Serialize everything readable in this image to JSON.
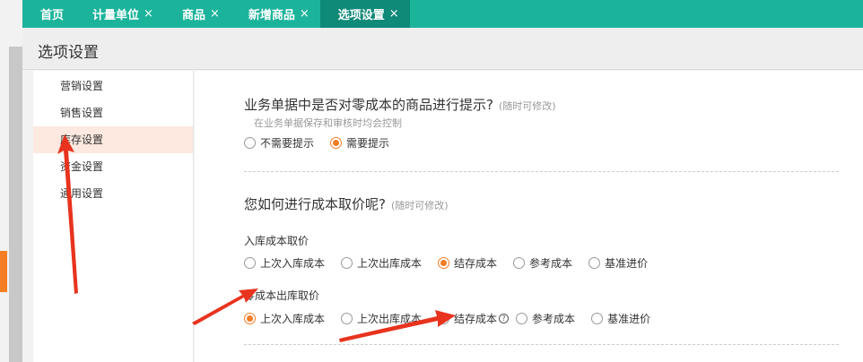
{
  "tabs": [
    {
      "label": "首页",
      "closable": false,
      "active": false
    },
    {
      "label": "计量单位",
      "closable": true,
      "active": false
    },
    {
      "label": "商品",
      "closable": true,
      "active": false
    },
    {
      "label": "新增商品",
      "closable": true,
      "active": false
    },
    {
      "label": "选项设置",
      "closable": true,
      "active": true
    }
  ],
  "close_glyph": "×",
  "page_title": "选项设置",
  "sidebar": {
    "items": [
      {
        "label": "营销设置"
      },
      {
        "label": "销售设置"
      },
      {
        "label": "库存设置"
      },
      {
        "label": "资金设置"
      },
      {
        "label": "通用设置"
      }
    ],
    "active_index": 2
  },
  "section1": {
    "title": "业务单据中是否对零成本的商品进行提示?",
    "note": "(随时可修改)",
    "subtitle": "在业务单据保存和审核时均会控制",
    "options": [
      {
        "label": "不需要提示",
        "selected": false
      },
      {
        "label": "需要提示",
        "selected": true
      }
    ]
  },
  "section2": {
    "title": "您如何进行成本取价呢?",
    "note": "(随时可修改)",
    "group1": {
      "label": "入库成本取价",
      "options": [
        {
          "label": "上次入库成本",
          "selected": false
        },
        {
          "label": "上次出库成本",
          "selected": false
        },
        {
          "label": "结存成本",
          "selected": true
        },
        {
          "label": "参考成本",
          "selected": false
        },
        {
          "label": "基准进价",
          "selected": false
        }
      ]
    },
    "group2": {
      "label": "零成本出库取价",
      "options": [
        {
          "label": "上次入库成本",
          "selected": true
        },
        {
          "label": "上次出库成本",
          "selected": false
        },
        {
          "label": "结存成本",
          "selected": false
        },
        {
          "label": "参考成本",
          "selected": false
        },
        {
          "label": "基准进价",
          "selected": false
        }
      ],
      "help_glyph": "?"
    }
  },
  "colors": {
    "tabbar": "#1cb39b",
    "tab_active": "#0f8978",
    "accent": "#f57d23",
    "arrow": "#e8331e"
  }
}
